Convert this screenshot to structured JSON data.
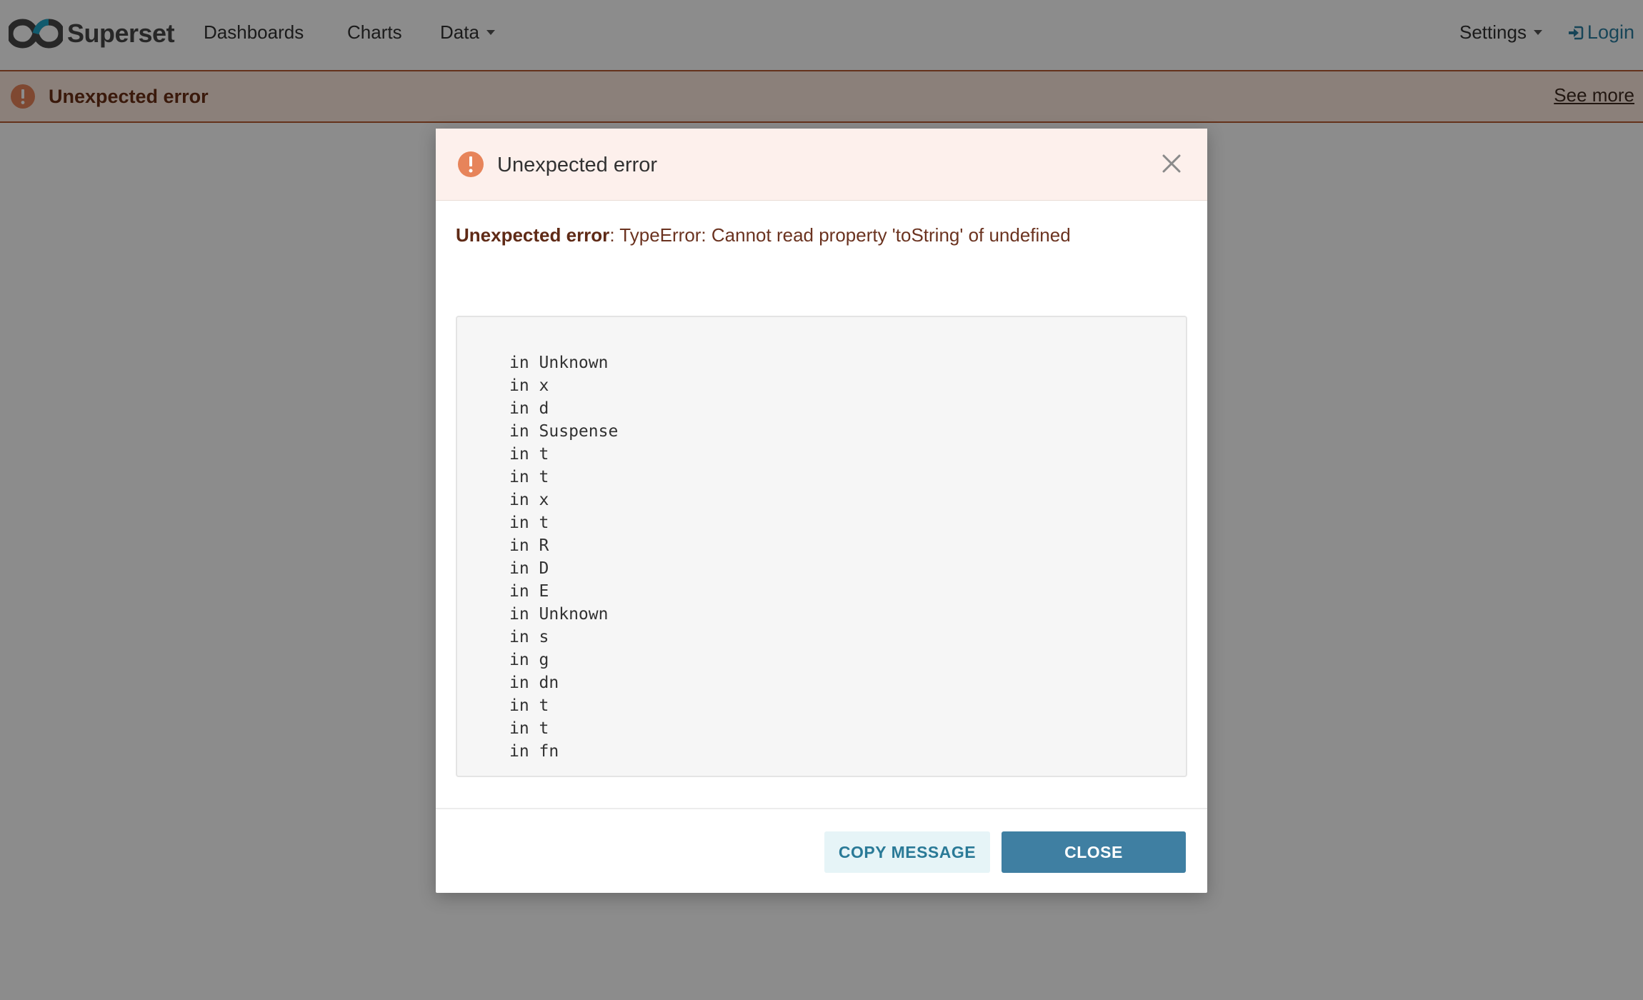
{
  "navbar": {
    "brand": "Superset",
    "items": [
      {
        "label": "Dashboards"
      },
      {
        "label": "Charts"
      },
      {
        "label": "Data"
      }
    ],
    "settings_label": "Settings",
    "login_label": "Login"
  },
  "toast": {
    "text": "Unexpected error",
    "see_more": "See more"
  },
  "modal": {
    "title": "Unexpected error",
    "message_bold": "Unexpected error",
    "message_rest": ": TypeError: Cannot read property 'toString' of undefined",
    "stack": [
      "in Unknown",
      "in x",
      "in d",
      "in Suspense",
      "in t",
      "in t",
      "in x",
      "in t",
      "in R",
      "in D",
      "in E",
      "in Unknown",
      "in s",
      "in g",
      "in dn",
      "in t",
      "in t",
      "in fn"
    ],
    "copy_label": "COPY MESSAGE",
    "close_label": "CLOSE"
  },
  "colors": {
    "accent": "#3f7fa2",
    "error": "#e7845a",
    "error_dark": "#b75c32"
  }
}
